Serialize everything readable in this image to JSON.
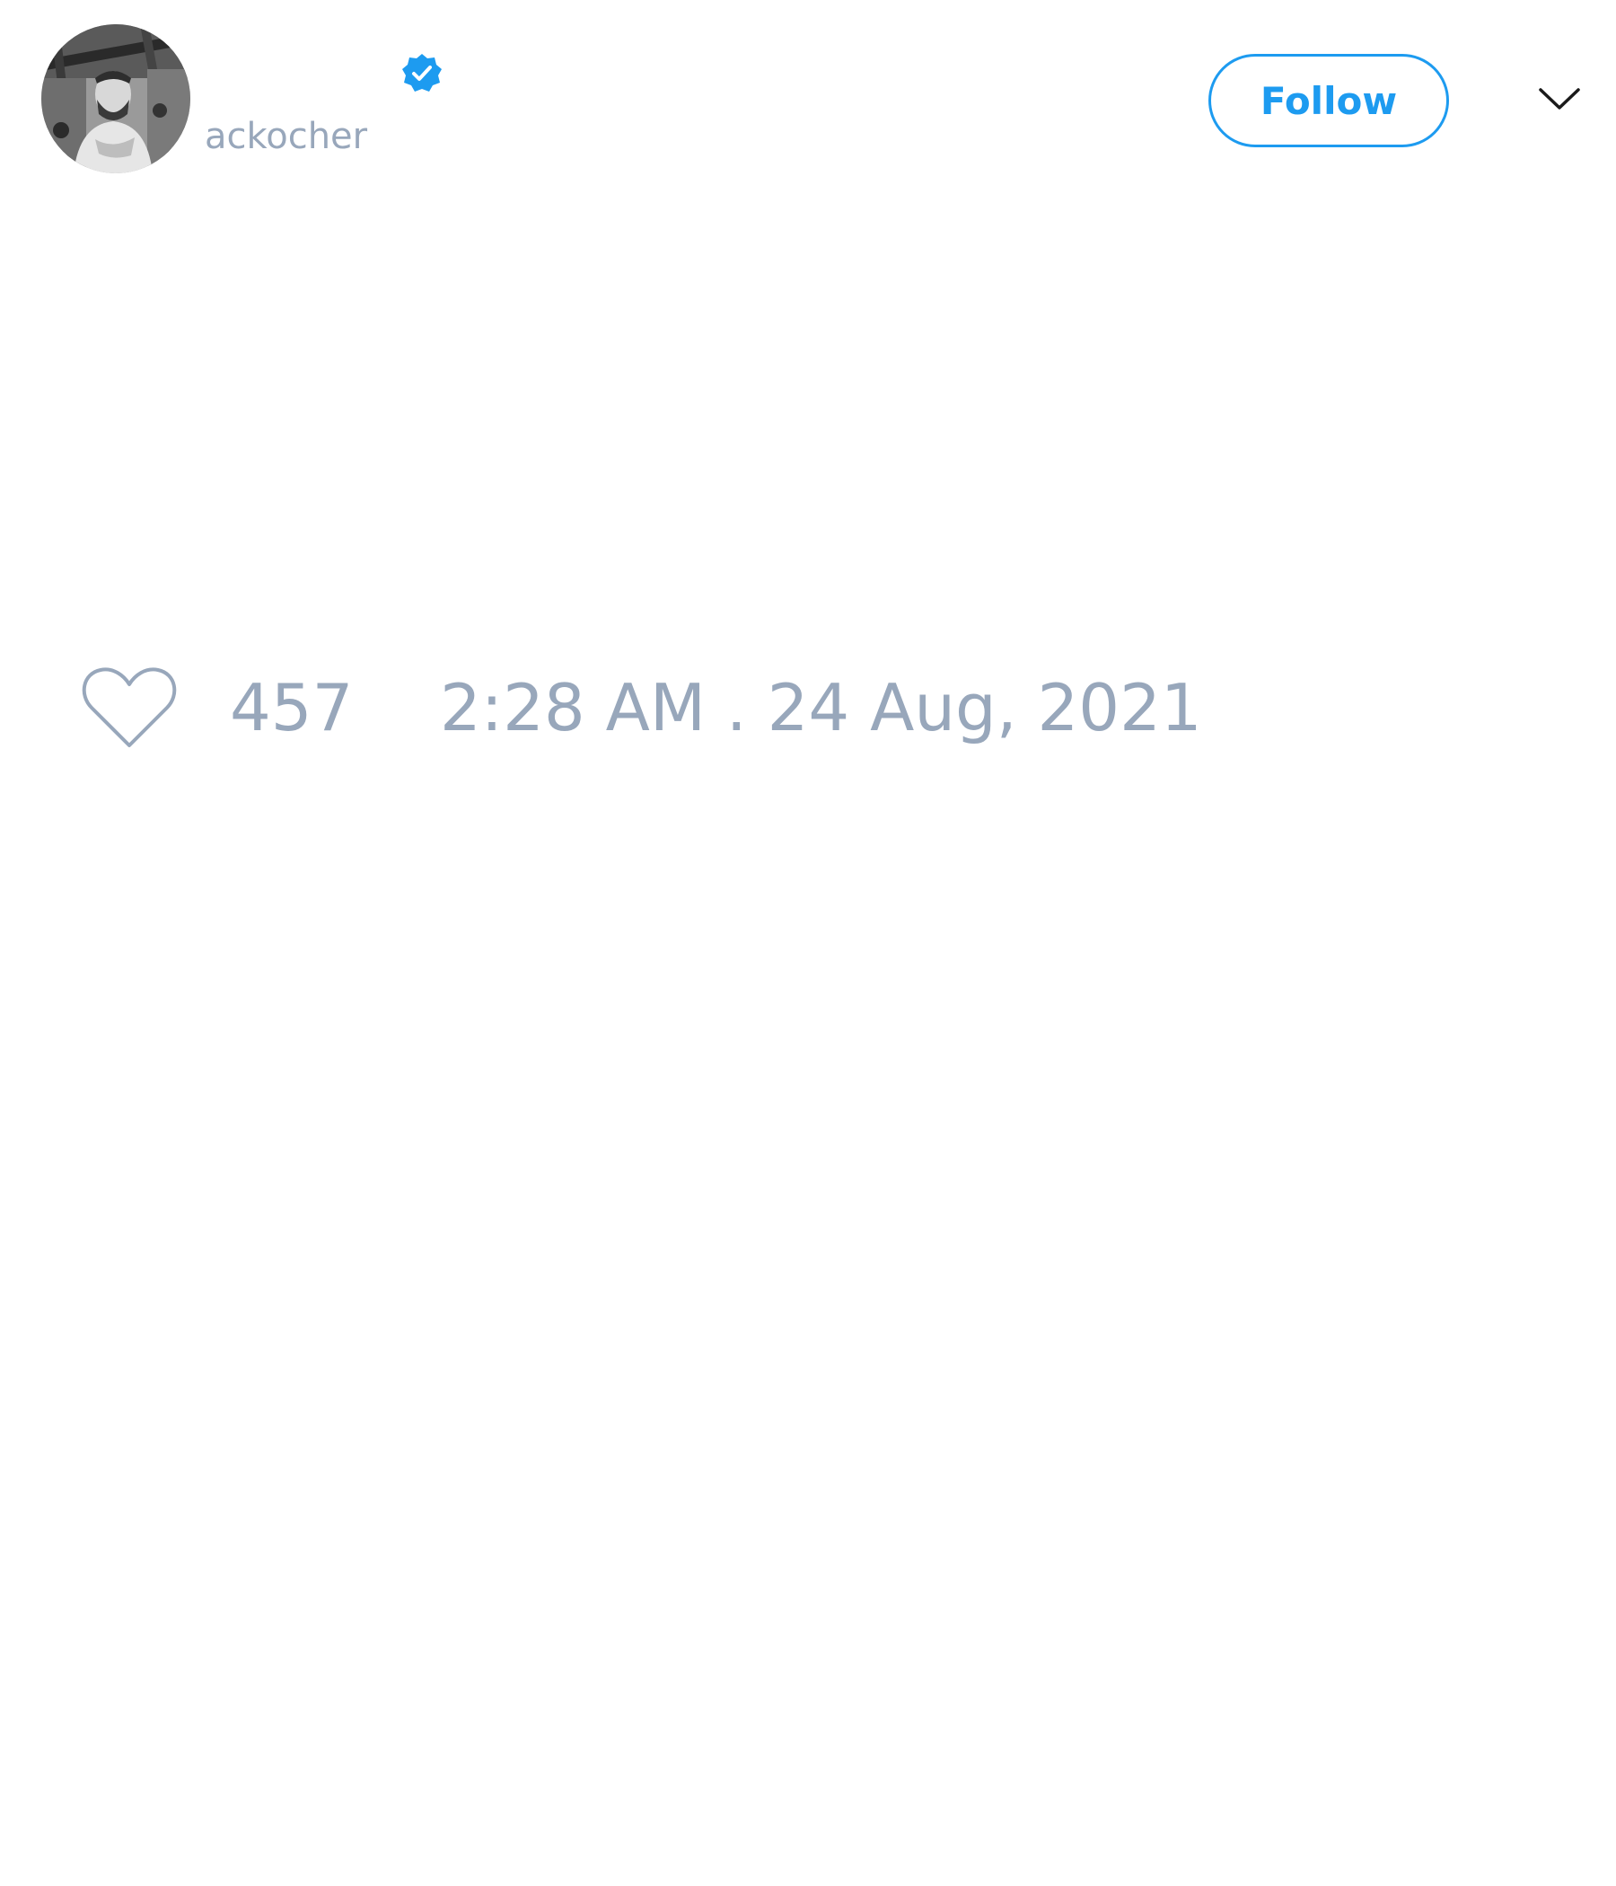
{
  "author": {
    "handle": "ackocher",
    "avatar_icon": "profile-photo",
    "verified_icon": "verified-badge-icon"
  },
  "header": {
    "follow_label": "Follow",
    "menu_icon": "chevron-down-icon"
  },
  "engagement": {
    "like_icon": "heart-icon",
    "like_count": "457",
    "timestamp": "2:28 AM . 24 Aug, 2021"
  },
  "colors": {
    "accent": "#1d9bf0",
    "muted_text": "#98a7bb",
    "background": "#ffffff"
  }
}
